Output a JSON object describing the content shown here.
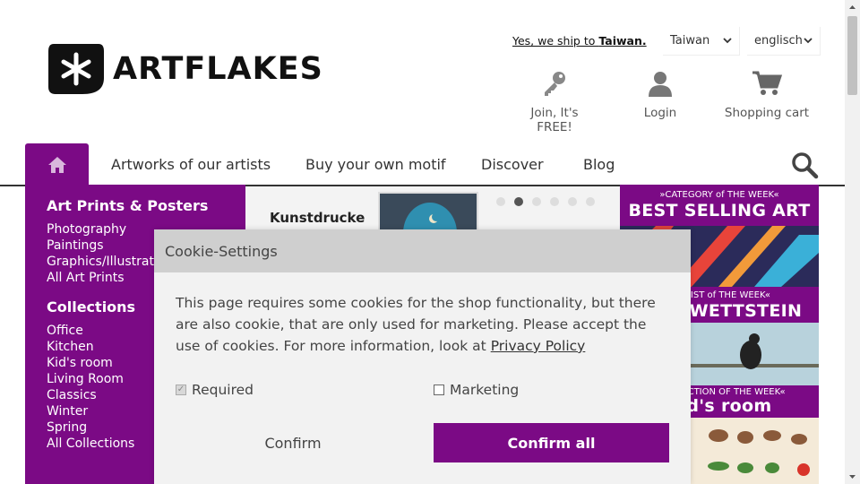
{
  "header": {
    "logo_text": "ARTFLAKES",
    "ship_prefix": "Yes, we ship to ",
    "ship_country": "Taiwan.",
    "country_select": "Taiwan",
    "language_select": "englisch",
    "actions": [
      {
        "label": "Join, It's FREE!",
        "icon": "key-icon"
      },
      {
        "label": "Login",
        "icon": "user-icon"
      },
      {
        "label": "Shopping cart",
        "icon": "cart-icon"
      }
    ]
  },
  "nav": {
    "home_icon": "home-icon",
    "items": [
      "Artworks of our artists",
      "Buy your own motif",
      "Discover",
      "Blog"
    ],
    "search_icon": "search-icon"
  },
  "sidebar": {
    "groups": [
      {
        "title": "Art Prints & Posters",
        "links": [
          "Photography",
          "Paintings",
          "Graphics/Illustrations",
          "All Art Prints"
        ]
      },
      {
        "title": "Collections",
        "links": [
          "Office",
          "Kitchen",
          "Kid's room",
          "Living Room",
          "Classics",
          "Winter",
          "Spring",
          "All Collections"
        ]
      }
    ]
  },
  "carousel": {
    "slide_title": "Kunstdrucke",
    "active_index": 1,
    "count": 6
  },
  "promo": {
    "cat_small": "»CATEGORY of THE WEEK«",
    "cat_big": "BEST SELLING ART",
    "artist_small": "»ARTIST of THE WEEK«",
    "artist_big": "TINA WETTSTEIN",
    "coll_small": "»COLLECTION OF THE WEEK«",
    "coll_big": "Kid's room"
  },
  "cookie": {
    "title": "Cookie-Settings",
    "text": "This page requires some cookies for the shop functionality, but there are also cookie, that are only used for marketing. Please accept the use of cookies. For more information, look at ",
    "privacy_link": "Privacy Policy",
    "required_label": "Required",
    "marketing_label": "Marketing",
    "confirm_label": "Confirm",
    "confirm_all_label": "Confirm all"
  },
  "colors": {
    "brand_purple": "#7b0a85"
  }
}
